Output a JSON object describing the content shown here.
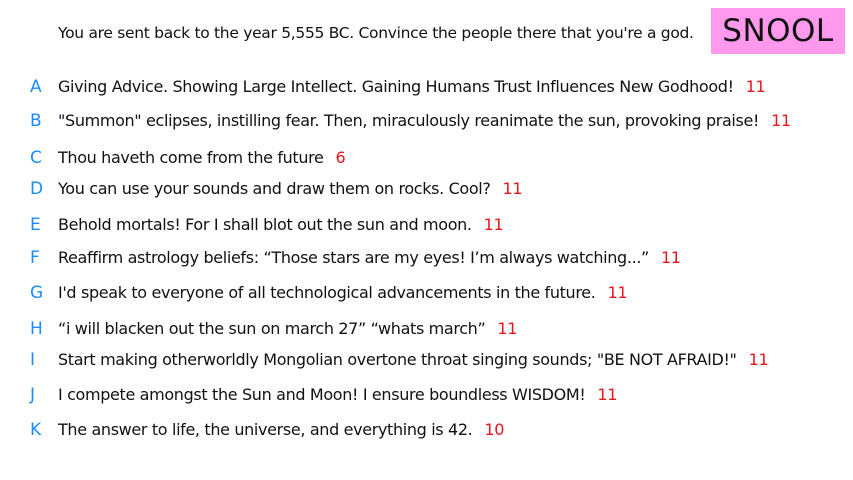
{
  "prompt": "You are sent back to the year 5,555 BC. Convince the people there that you're a god.",
  "logo": "SNOOL",
  "colors": {
    "letter": "#1a8cff",
    "score": "#e8161c",
    "logo_bg": "#ff99ee"
  },
  "answers": [
    {
      "letter": "A",
      "text": "Giving Advice. Showing Large Intellect. Gaining Humans Trust Influences New Godhood!",
      "score": "11"
    },
    {
      "letter": "B",
      "text": "\"Summon\" eclipses, instilling fear. Then, miraculously reanimate the sun, provoking praise!",
      "score": "11"
    },
    {
      "letter": "C",
      "text": "Thou haveth come from the future",
      "score": "6"
    },
    {
      "letter": "D",
      "text": "You can use your sounds and draw them on rocks. Cool?",
      "score": "11"
    },
    {
      "letter": "E",
      "text": "Behold mortals!  For I shall blot out the sun and moon.",
      "score": "11"
    },
    {
      "letter": "F",
      "text": "Reaffirm astrology beliefs: “Those stars are my eyes! I’m always watching...”",
      "score": "11"
    },
    {
      "letter": "G",
      "text": "I'd speak to everyone of all technological advancements in the future.",
      "score": "11"
    },
    {
      "letter": "H",
      "text": "“i will blacken out the sun on march 27” “whats march”",
      "score": "11"
    },
    {
      "letter": "I",
      "text": "Start making otherworldly Mongolian overtone throat singing sounds; \"BE NOT AFRAID!\"",
      "score": "11"
    },
    {
      "letter": "J",
      "text": "I compete amongst the Sun and Moon! I ensure boundless WISDOM!",
      "score": "11"
    },
    {
      "letter": "K",
      "text": "The answer to life, the universe, and everything is 42.",
      "score": "10"
    }
  ]
}
